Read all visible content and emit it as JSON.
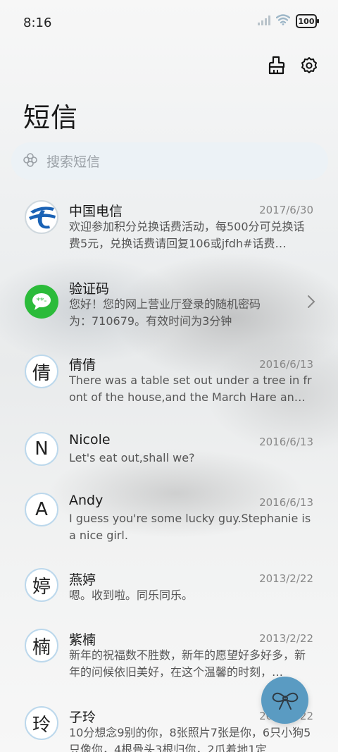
{
  "status": {
    "time": "8:16",
    "battery": "100"
  },
  "header": {
    "title": "短信"
  },
  "search": {
    "placeholder": "搜索短信"
  },
  "conversations": [
    {
      "name": "中国电信",
      "date": "2017/6/30",
      "preview": "欢迎参加积分兑换话费活动，每500分可兑换话费5元，兑换话费请回复106或jfdh#话费…",
      "avatar": "telecom-logo"
    },
    {
      "name": "验证码",
      "date": "",
      "preview": "您好！您的网上营业厅登录的随机密码为：710679。有效时间为3分钟",
      "avatar": "message-logo"
    },
    {
      "name": "倩倩",
      "date": "2016/6/13",
      "preview": "There was a table set out under a tree in front of the house,and the March Hare an…",
      "avatar": "倩"
    },
    {
      "name": "Nicole",
      "date": "2016/6/13",
      "preview": "Let's eat out,shall we?",
      "avatar": "N"
    },
    {
      "name": "Andy",
      "date": "2016/6/13",
      "preview": "I guess you're some lucky guy.Stephanie is a nice girl.",
      "avatar": "A"
    },
    {
      "name": "燕婷",
      "date": "2013/2/22",
      "preview": "嗯。收到啦。同乐同乐。",
      "avatar": "婷"
    },
    {
      "name": "紫楠",
      "date": "2013/2/22",
      "preview": "新年的祝福数不胜数，新年的愿望好多好多，新年的问候依旧美好，在这个温馨的时刻，…",
      "avatar": "楠"
    },
    {
      "name": "子玲",
      "date": "2013/2/22",
      "preview": "10分想念9别的你，8张照片7张是你，6只小狗5只像你，4根骨头3根归你，2爪着地1定…",
      "avatar": "玲"
    }
  ],
  "colors": {
    "accent": "#5a9bc2",
    "avatar_border": "#bcd8ec",
    "telecom_blue": "#1a62b5",
    "message_green": "#2bbb3a"
  }
}
